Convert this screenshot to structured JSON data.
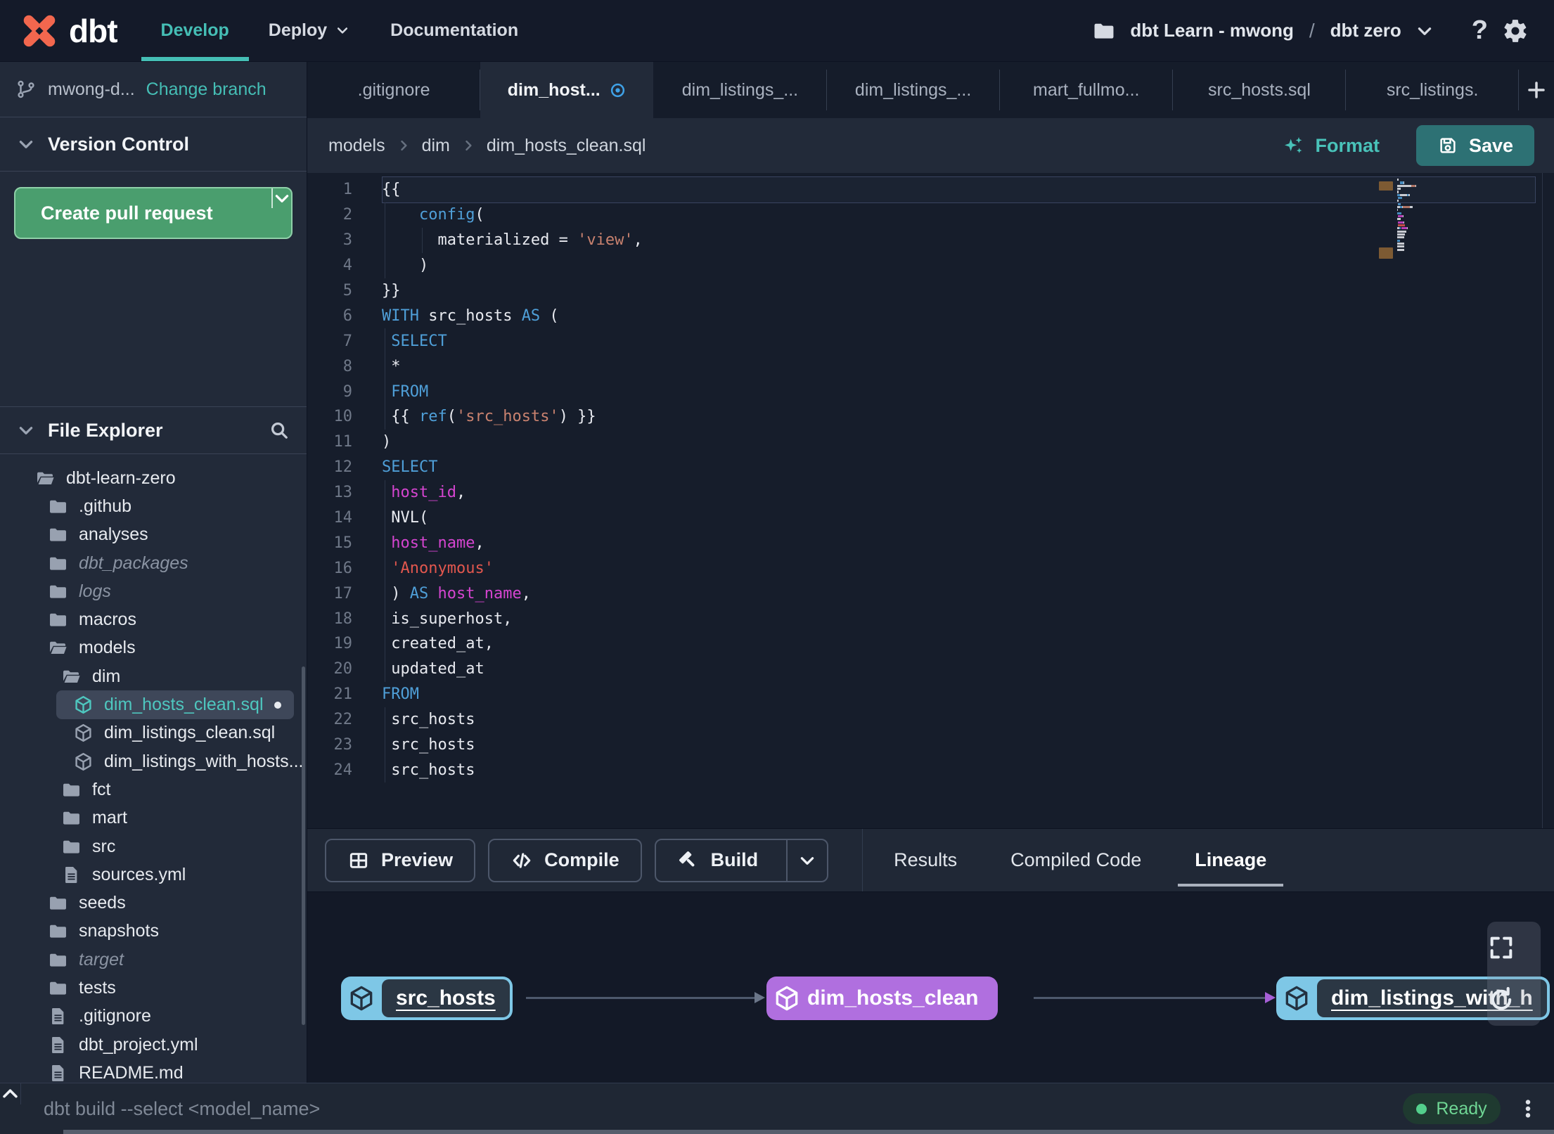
{
  "colors": {
    "accent_teal": "#45beb5",
    "green_button": "#4a9e6e",
    "save_button": "#2d7174",
    "status_green": "#53cf8c",
    "node_blue": "#7ec7e6",
    "node_purple": "#b06fdf",
    "edge_gray": "#6b7689",
    "edge_purple": "#a65fd6",
    "modified_blue": "#3fa2e8",
    "syntax": {
      "kw": "#4f9fd8",
      "str": "#c9826f",
      "str2": "#e2574e",
      "id": "#d545d0",
      "p": "#e8eaf0",
      "ln": "#6f7888"
    }
  },
  "header": {
    "brand": "dbt",
    "nav": [
      {
        "label": "Develop",
        "active": true,
        "chevron": false
      },
      {
        "label": "Deploy",
        "active": false,
        "chevron": true
      },
      {
        "label": "Documentation",
        "active": false,
        "chevron": false
      }
    ],
    "project": "dbt Learn - mwong",
    "path_separator": "/",
    "environment": "dbt zero"
  },
  "sidebar": {
    "branch": {
      "name": "mwong-d...",
      "change_label": "Change branch"
    },
    "version_control": {
      "title": "Version Control",
      "create_pr": "Create pull request"
    },
    "file_explorer": {
      "title": "File Explorer",
      "tree": [
        {
          "label": "dbt-learn-zero",
          "type": "folder-open",
          "level": 0
        },
        {
          "label": ".github",
          "type": "folder",
          "level": 1
        },
        {
          "label": "analyses",
          "type": "folder",
          "level": 1
        },
        {
          "label": "dbt_packages",
          "type": "folder",
          "level": 1,
          "muted": true
        },
        {
          "label": "logs",
          "type": "folder",
          "level": 1,
          "muted": true
        },
        {
          "label": "macros",
          "type": "folder",
          "level": 1
        },
        {
          "label": "models",
          "type": "folder-open",
          "level": 1
        },
        {
          "label": "dim",
          "type": "folder-open",
          "level": 2
        },
        {
          "label": "dim_hosts_clean.sql",
          "type": "model",
          "level": 3,
          "selected": true,
          "dot": true
        },
        {
          "label": "dim_listings_clean.sql",
          "type": "model",
          "level": 3
        },
        {
          "label": "dim_listings_with_hosts...",
          "type": "model",
          "level": 3
        },
        {
          "label": "fct",
          "type": "folder",
          "level": 2
        },
        {
          "label": "mart",
          "type": "folder",
          "level": 2
        },
        {
          "label": "src",
          "type": "folder",
          "level": 2
        },
        {
          "label": "sources.yml",
          "type": "file",
          "level": 2
        },
        {
          "label": "seeds",
          "type": "folder",
          "level": 1
        },
        {
          "label": "snapshots",
          "type": "folder",
          "level": 1
        },
        {
          "label": "target",
          "type": "folder",
          "level": 1,
          "muted": true
        },
        {
          "label": "tests",
          "type": "folder",
          "level": 1
        },
        {
          "label": ".gitignore",
          "type": "file",
          "level": 1
        },
        {
          "label": "dbt_project.yml",
          "type": "file",
          "level": 1
        },
        {
          "label": "README.md",
          "type": "file",
          "level": 1
        }
      ]
    }
  },
  "tabs": [
    {
      "label": ".gitignore"
    },
    {
      "label": "dim_host...",
      "active": true,
      "modified": true
    },
    {
      "label": "dim_listings_..."
    },
    {
      "label": "dim_listings_..."
    },
    {
      "label": "mart_fullmo..."
    },
    {
      "label": "src_hosts.sql"
    },
    {
      "label": "src_listings."
    }
  ],
  "editor": {
    "breadcrumb": [
      "models",
      "dim",
      "dim_hosts_clean.sql"
    ],
    "format_label": "Format",
    "save_label": "Save",
    "lines": [
      {
        "n": 1,
        "cur": true,
        "g": [],
        "s": [
          [
            "{{",
            "p"
          ]
        ]
      },
      {
        "n": 2,
        "g": [
          0
        ],
        "s": [
          [
            "    ",
            "p"
          ],
          [
            "config",
            "kw"
          ],
          [
            "(",
            "p"
          ]
        ]
      },
      {
        "n": 3,
        "g": [
          0,
          4
        ],
        "s": [
          [
            "      materialized = ",
            "p"
          ],
          [
            "'view'",
            "str"
          ],
          [
            ",",
            "p"
          ]
        ]
      },
      {
        "n": 4,
        "g": [
          0
        ],
        "s": [
          [
            "    )",
            "p"
          ]
        ]
      },
      {
        "n": 5,
        "g": [],
        "s": [
          [
            "}}",
            "p"
          ]
        ]
      },
      {
        "n": 6,
        "g": [],
        "s": [
          [
            "WITH",
            "kw"
          ],
          [
            " src_hosts ",
            "p"
          ],
          [
            "AS",
            "kw"
          ],
          [
            " (",
            "p"
          ]
        ]
      },
      {
        "n": 7,
        "g": [
          0
        ],
        "s": [
          [
            " ",
            "p"
          ],
          [
            "SELECT",
            "kw"
          ]
        ]
      },
      {
        "n": 8,
        "g": [
          0
        ],
        "s": [
          [
            " *",
            "p"
          ]
        ]
      },
      {
        "n": 9,
        "g": [
          0
        ],
        "s": [
          [
            " ",
            "p"
          ],
          [
            "FROM",
            "kw"
          ]
        ]
      },
      {
        "n": 10,
        "g": [
          0
        ],
        "s": [
          [
            " {{ ",
            "p"
          ],
          [
            "ref",
            "kw"
          ],
          [
            "(",
            "p"
          ],
          [
            "'src_hosts'",
            "str"
          ],
          [
            ") }}",
            "p"
          ]
        ]
      },
      {
        "n": 11,
        "g": [],
        "s": [
          [
            ")",
            "p"
          ]
        ]
      },
      {
        "n": 12,
        "g": [],
        "s": [
          [
            "SELECT",
            "kw"
          ]
        ]
      },
      {
        "n": 13,
        "g": [
          0
        ],
        "s": [
          [
            " ",
            "p"
          ],
          [
            "host_id",
            "id"
          ],
          [
            ",",
            "p"
          ]
        ]
      },
      {
        "n": 14,
        "g": [
          0
        ],
        "s": [
          [
            " NVL(",
            "p"
          ]
        ]
      },
      {
        "n": 15,
        "g": [
          0
        ],
        "s": [
          [
            " ",
            "p"
          ],
          [
            "host_name",
            "id"
          ],
          [
            ",",
            "p"
          ]
        ]
      },
      {
        "n": 16,
        "g": [
          0
        ],
        "s": [
          [
            " ",
            "p"
          ],
          [
            "'Anonymous'",
            "str2"
          ]
        ]
      },
      {
        "n": 17,
        "g": [
          0
        ],
        "s": [
          [
            " ) ",
            "p"
          ],
          [
            "AS",
            "kw"
          ],
          [
            " ",
            "p"
          ],
          [
            "host_name",
            "id"
          ],
          [
            ",",
            "p"
          ]
        ]
      },
      {
        "n": 18,
        "g": [
          0
        ],
        "s": [
          [
            " is_superhost,",
            "p"
          ]
        ]
      },
      {
        "n": 19,
        "g": [
          0
        ],
        "s": [
          [
            " created_at,",
            "p"
          ]
        ]
      },
      {
        "n": 20,
        "g": [
          0
        ],
        "s": [
          [
            " updated_at",
            "p"
          ]
        ]
      },
      {
        "n": 21,
        "g": [],
        "s": [
          [
            "FROM",
            "kw"
          ]
        ]
      },
      {
        "n": 22,
        "g": [
          0
        ],
        "s": [
          [
            " src_hosts",
            "p"
          ]
        ]
      },
      {
        "n": 23,
        "g": [
          0
        ],
        "s": [
          [
            " src_hosts",
            "p"
          ]
        ]
      },
      {
        "n": 24,
        "g": [
          0
        ],
        "s": [
          [
            " src_hosts",
            "p"
          ]
        ]
      }
    ]
  },
  "panel": {
    "actions": [
      {
        "label": "Preview",
        "icon": "table-icon"
      },
      {
        "label": "Compile",
        "icon": "code-icon"
      },
      {
        "label": "Build",
        "icon": "hammer-icon",
        "split": true
      }
    ],
    "tabs": [
      {
        "label": "Results"
      },
      {
        "label": "Compiled Code"
      },
      {
        "label": "Lineage",
        "active": true
      }
    ],
    "lineage_nodes": [
      {
        "label": "src_hosts",
        "style": "blue"
      },
      {
        "label": "dim_hosts_clean",
        "style": "purple"
      },
      {
        "label": "dim_listings_with_h",
        "style": "blue"
      }
    ]
  },
  "command_bar": {
    "placeholder": "dbt build --select <model_name>",
    "status": "Ready"
  }
}
